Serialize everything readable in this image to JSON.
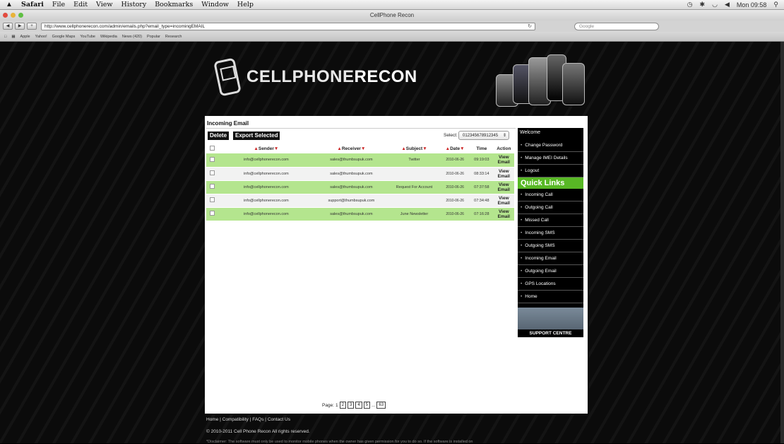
{
  "menubar": {
    "apple": "",
    "items": [
      "Safari",
      "File",
      "Edit",
      "View",
      "History",
      "Bookmarks",
      "Window",
      "Help"
    ],
    "clock": "Mon 09:58"
  },
  "window": {
    "title": "CellPhone Recon"
  },
  "toolbar": {
    "url": "http://www.cellphonerecon.com/admin/emails.php?email_type=incomingEMAIL",
    "search_placeholder": "Google"
  },
  "bookmarks": [
    "Apple",
    "Yahoo!",
    "Google Maps",
    "YouTube",
    "Wikipedia",
    "News (420)",
    "Popular",
    "Research"
  ],
  "logo": {
    "text_light": "CELLPHONE",
    "text_bold": "RECON"
  },
  "content": {
    "heading": "Incoming Email",
    "delete_label": "Delete",
    "export_label": "Export Selected",
    "select_label": "Select:",
    "select_value": "012345678912345",
    "columns": [
      "Sender",
      "Receiver",
      "Subject",
      "Date",
      "Time",
      "Action"
    ],
    "rows": [
      {
        "sender": "info@cellphonerecon.com",
        "receiver": "sales@thumbsupuk.com",
        "subject": "Twitter",
        "date": "2010-06-26",
        "time": "09:19:03",
        "action": "View Email"
      },
      {
        "sender": "info@cellphonerecon.com",
        "receiver": "sales@thumbsupuk.com",
        "subject": "",
        "date": "2010-06-26",
        "time": "08:33:14",
        "action": "View Email"
      },
      {
        "sender": "info@cellphonerecon.com",
        "receiver": "sales@thumbsupuk.com",
        "subject": "Request For Account",
        "date": "2010-06-26",
        "time": "07:37:58",
        "action": "View Email"
      },
      {
        "sender": "info@cellphonerecon.com",
        "receiver": "support@thumbsupuk.com",
        "subject": "",
        "date": "2010-06-26",
        "time": "07:34:48",
        "action": "View Email"
      },
      {
        "sender": "info@cellphonerecon.com",
        "receiver": "sales@thumbsupuk.com",
        "subject": "June Newsletter",
        "date": "2010-06-26",
        "time": "07:16:28",
        "action": "View Email"
      }
    ],
    "pager": {
      "label": "Page:",
      "current": "1",
      "pages": [
        "2",
        "3",
        "4",
        "5"
      ],
      "ellipsis": "...",
      "last": "63"
    }
  },
  "sidebar": {
    "welcome": "Welcome",
    "account_links": [
      "Change Password",
      "Manage IMEI Details",
      "Logout"
    ],
    "quick_title": "Quick Links",
    "quick_links": [
      "Incoming Call",
      "Outgoing Call",
      "Missed Call",
      "Incoming SMS",
      "Outgoing SMS",
      "Incoming Email",
      "Outgoing Email",
      "GPS Locations",
      "Home"
    ],
    "support_label": "SUPPORT CENTRE"
  },
  "footer": {
    "links": [
      "Home",
      "Compatibility",
      "FAQs",
      "Contact Us"
    ],
    "separator": "|",
    "copyright": "© 2010-2011 Cell Phone Recon All rights reserved.",
    "disclaimer": "*Disclaimer: The software must only be used to monitor mobile phones when the owner has given permission for you to do so. If the software is installed on"
  },
  "colors": {
    "row_green": "#b4e58e",
    "quick_links_green": "#58b825",
    "sort_arrow": "#cc2222"
  }
}
